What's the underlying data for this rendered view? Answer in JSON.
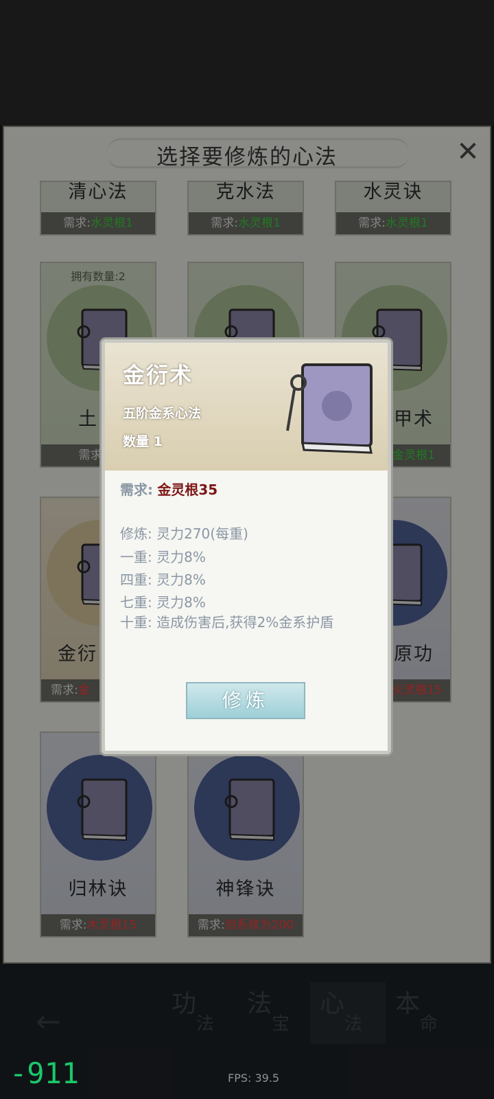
{
  "panel": {
    "title": "选择要修炼的心法",
    "close_icon": "close-icon"
  },
  "cards": [
    {
      "name": "清心法",
      "req_label": "需求:",
      "req_value": "水灵根1",
      "req_color": "green"
    },
    {
      "name": "克水法",
      "req_label": "需求:",
      "req_value": "水灵根1",
      "req_color": "green"
    },
    {
      "name": "水灵诀",
      "req_label": "需求:",
      "req_value": "水灵根1",
      "req_color": "green"
    },
    {
      "count": "拥有数量:2",
      "name": "土甲",
      "req_label": "需求:",
      "req_value": "土",
      "req_color": "green"
    },
    {
      "name": "",
      "req_label": "",
      "req_value": ""
    },
    {
      "name": "甲术",
      "req_label": "",
      "req_value": "金灵根1",
      "req_color": "green"
    },
    {
      "name": "金衍",
      "req_label": "需求:",
      "req_value": "金",
      "req_color": "red"
    },
    {
      "name": "",
      "req_label": "",
      "req_value": ""
    },
    {
      "name": "原功",
      "req_label": "",
      "req_value": "火灵根15",
      "req_color": "red"
    },
    {
      "name": "归林诀",
      "req_label": "需求:",
      "req_value": "木灵根15",
      "req_color": "red"
    },
    {
      "name": "神锋诀",
      "req_label": "需求:",
      "req_value": "剑系修为200",
      "req_color": "red"
    }
  ],
  "dialog": {
    "title": "金衍术",
    "subtitle": "五阶金系心法",
    "quantity": "数量 1",
    "req_label": "需求:",
    "req_value": "金灵根35",
    "train_label": "修炼:",
    "train_value": "灵力270(每重)",
    "layer1_label": "一重:",
    "layer1_value": "灵力8%",
    "layer4_label": "四重:",
    "layer4_value": "灵力8%",
    "layer7_label": "七重:",
    "layer7_value": "灵力8%",
    "layer10_label": "十重:",
    "layer10_value": "造成伤害后,获得2%金系护盾",
    "button": "修炼"
  },
  "bottom": {
    "tabs": [
      {
        "big": "功",
        "small": "法"
      },
      {
        "big": "法",
        "small": "宝"
      },
      {
        "big": "心",
        "small": "法"
      },
      {
        "big": "本",
        "small": "命"
      }
    ],
    "fps": "FPS: 39.5",
    "counter": "-911"
  }
}
